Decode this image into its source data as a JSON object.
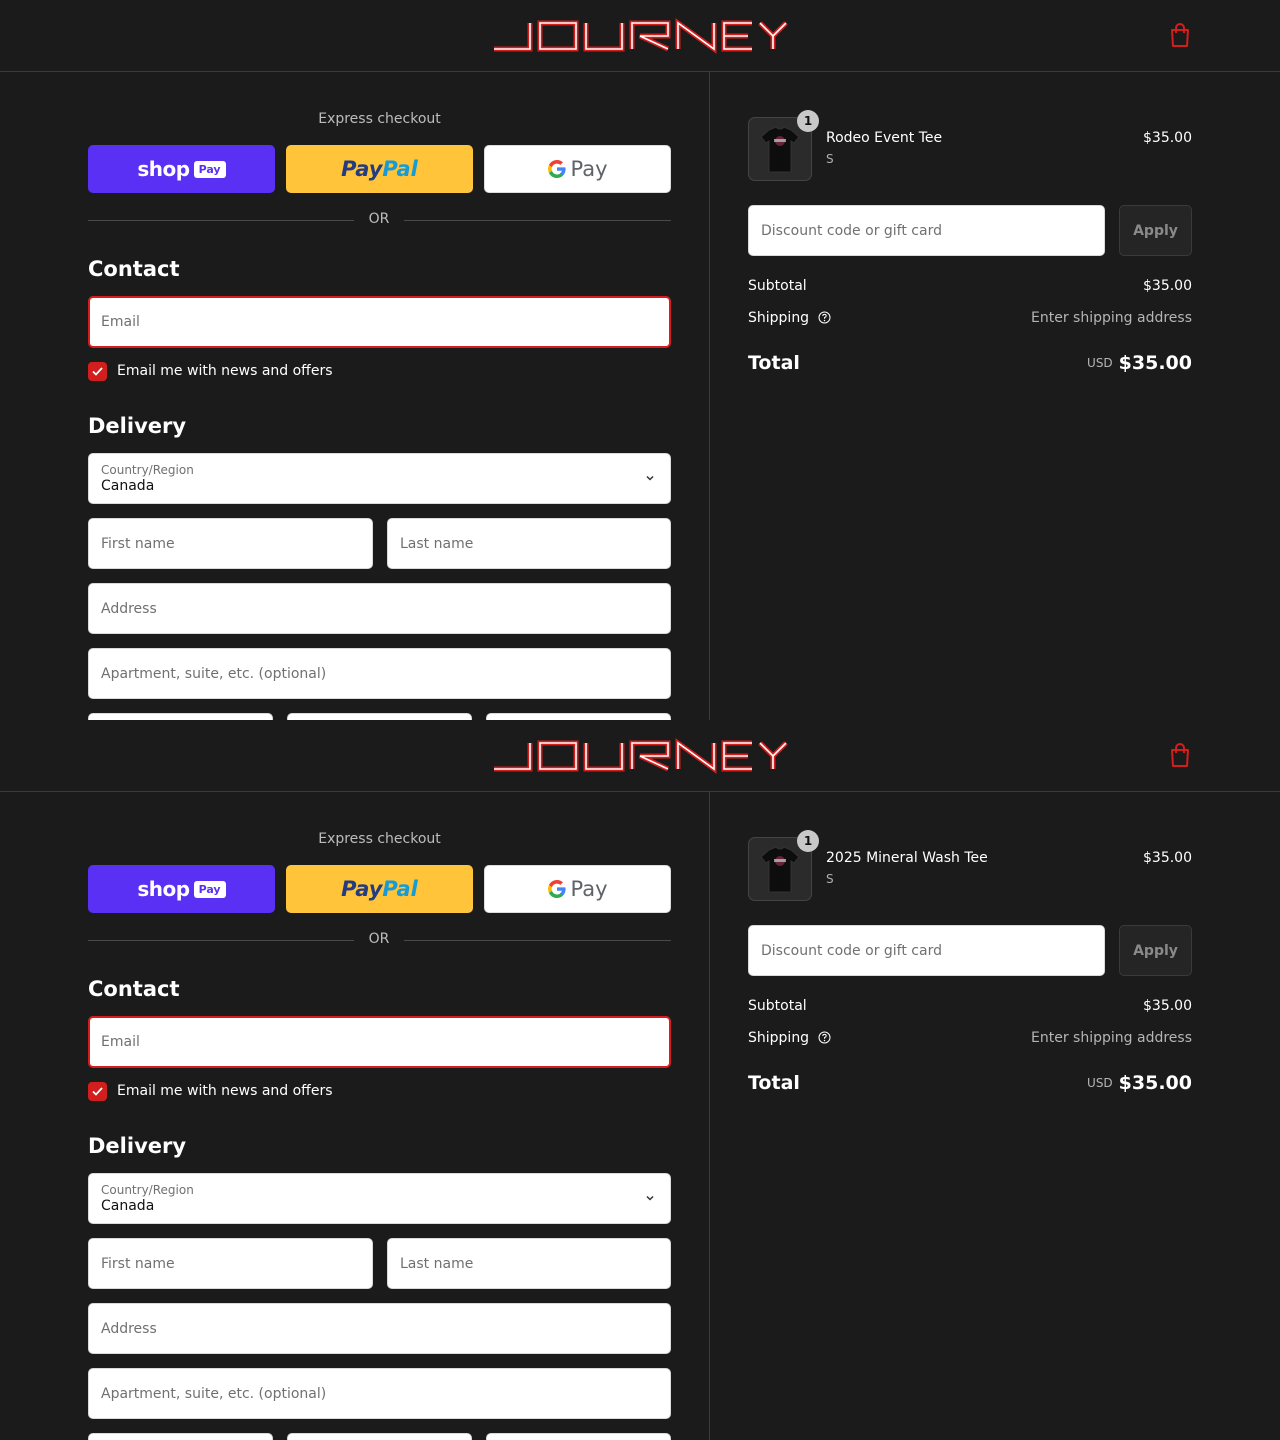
{
  "brand": {
    "logo_text": "JOURNEY",
    "accent_color": "#d31e1e",
    "logo_icon": "journey-wordmark",
    "cart_icon": "shopping-bag-icon"
  },
  "panels": [
    {
      "express_checkout_title": "Express checkout",
      "express_buttons": {
        "shop_pay": "shop",
        "shop_pay_badge": "Pay",
        "paypal_1": "Pay",
        "paypal_2": "Pal",
        "gpay": "Pay"
      },
      "or_text": "OR",
      "contact": {
        "title": "Contact",
        "email_placeholder": "Email",
        "newsletter_label": "Email me with news and offers",
        "newsletter_checked": true
      },
      "delivery": {
        "title": "Delivery",
        "country_label": "Country/Region",
        "country_value": "Canada",
        "first_name_placeholder": "First name",
        "last_name_placeholder": "Last name",
        "address_placeholder": "Address",
        "apartment_placeholder": "Apartment, suite, etc. (optional)"
      },
      "order": {
        "product_name": "Rodeo Event Tee",
        "variant": "S",
        "quantity": "1",
        "price": "$35.00",
        "discount_placeholder": "Discount code or gift card",
        "apply_label": "Apply",
        "subtotal_label": "Subtotal",
        "subtotal_value": "$35.00",
        "shipping_label": "Shipping",
        "shipping_value": "Enter shipping address",
        "total_label": "Total",
        "currency": "USD",
        "total_value": "$35.00"
      }
    },
    {
      "express_checkout_title": "Express checkout",
      "express_buttons": {
        "shop_pay": "shop",
        "shop_pay_badge": "Pay",
        "paypal_1": "Pay",
        "paypal_2": "Pal",
        "gpay": "Pay"
      },
      "or_text": "OR",
      "contact": {
        "title": "Contact",
        "email_placeholder": "Email",
        "newsletter_label": "Email me with news and offers",
        "newsletter_checked": true
      },
      "delivery": {
        "title": "Delivery",
        "country_label": "Country/Region",
        "country_value": "Canada",
        "first_name_placeholder": "First name",
        "last_name_placeholder": "Last name",
        "address_placeholder": "Address",
        "apartment_placeholder": "Apartment, suite, etc. (optional)"
      },
      "order": {
        "product_name": "2025 Mineral Wash Tee",
        "variant": "S",
        "quantity": "1",
        "price": "$35.00",
        "discount_placeholder": "Discount code or gift card",
        "apply_label": "Apply",
        "subtotal_label": "Subtotal",
        "subtotal_value": "$35.00",
        "shipping_label": "Shipping",
        "shipping_value": "Enter shipping address",
        "total_label": "Total",
        "currency": "USD",
        "total_value": "$35.00"
      }
    }
  ]
}
